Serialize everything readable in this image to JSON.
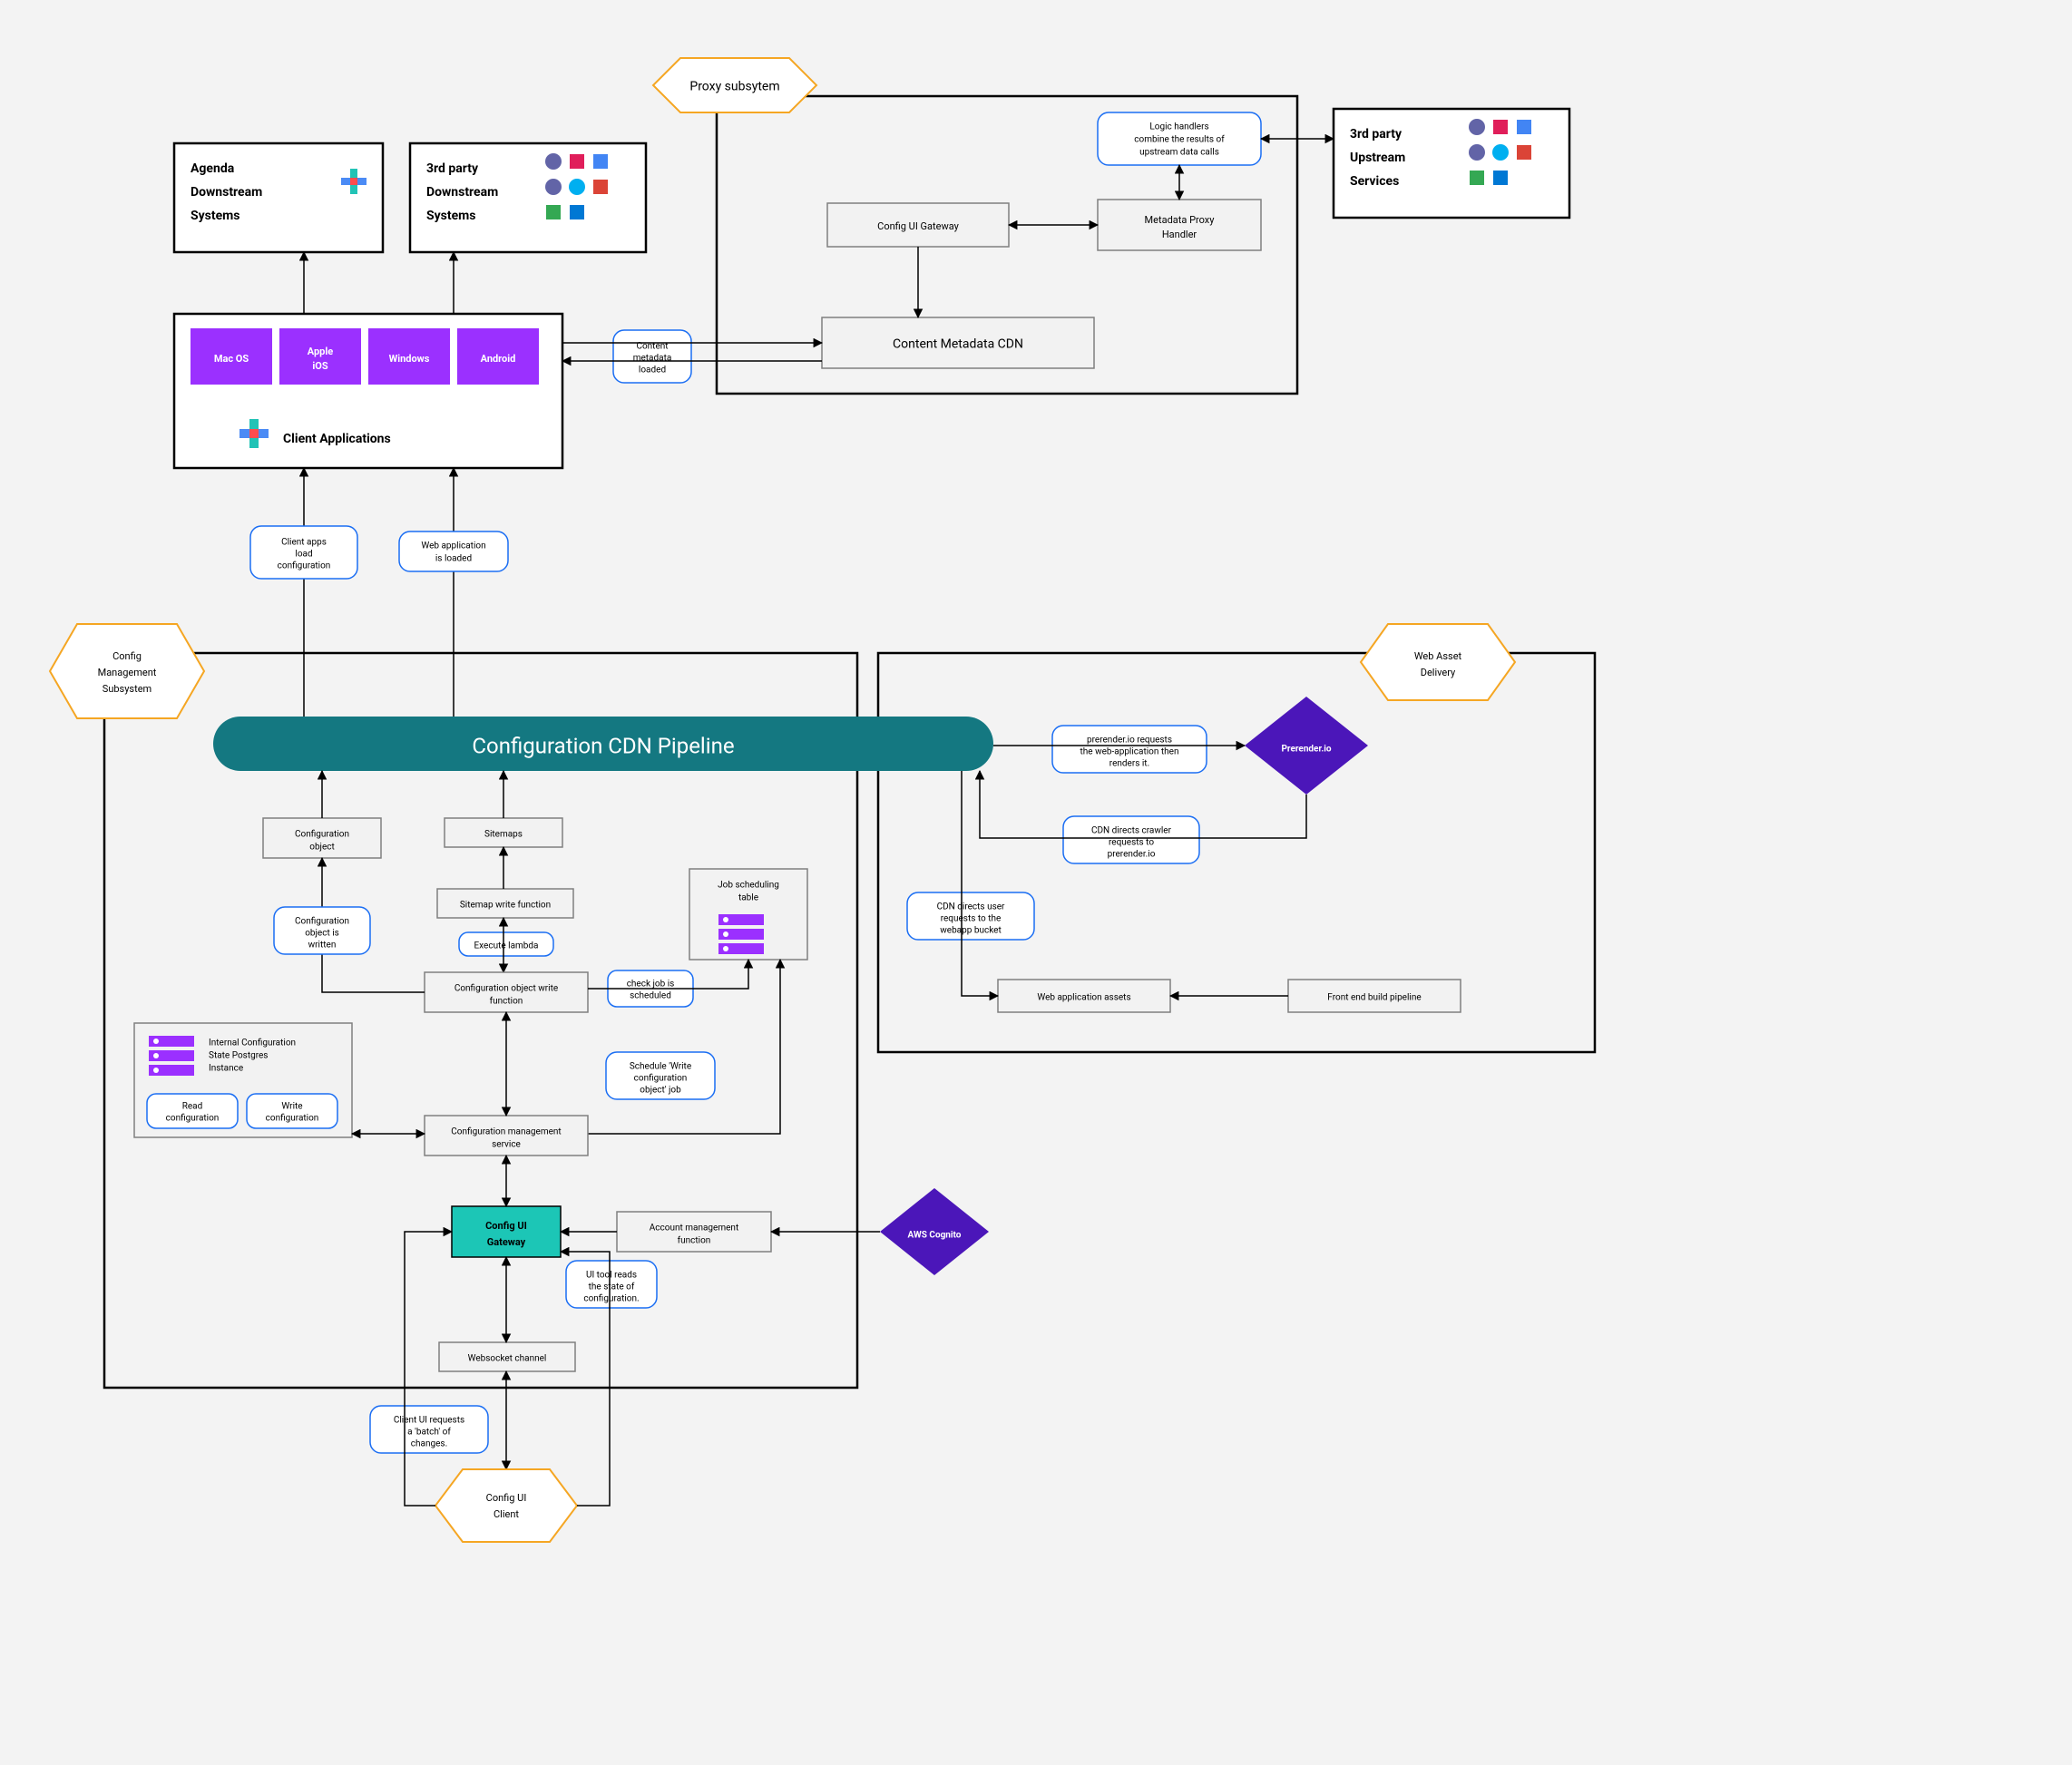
{
  "top": {
    "agenda_box_l1": "Agenda",
    "agenda_box_l2": "Downstream",
    "agenda_box_l3": "Systems",
    "thirdparty_down_l1": "3rd party",
    "thirdparty_down_l2": "Downstream",
    "thirdparty_down_l3": "Systems",
    "thirdparty_up_l1": "3rd party",
    "thirdparty_up_l2": "Upstream",
    "thirdparty_up_l3": "Services"
  },
  "clients": {
    "platforms": {
      "macos": "Mac OS",
      "ios1": "Apple",
      "ios2": "iOS",
      "windows": "Windows",
      "android": "Android"
    },
    "label": "Client Applications"
  },
  "hexes": {
    "proxy": "Proxy subsytem",
    "config_mgmt_l1": "Config",
    "config_mgmt_l2": "Management",
    "config_mgmt_l3": "Subsystem",
    "web_asset_l1": "Web Asset",
    "web_asset_l2": "Delivery",
    "config_ui_client_l1": "Config UI",
    "config_ui_client_l2": "Client"
  },
  "proxy": {
    "logic_handlers_l1": "Logic handlers",
    "logic_handlers_l2": "combine the results of",
    "logic_handlers_l3": "upstream data calls",
    "metadata_proxy_l1": "Metadata Proxy",
    "metadata_proxy_l2": "Handler",
    "config_ui_gateway": "Config UI Gateway",
    "content_cdn": "Content Metadata CDN"
  },
  "annot": {
    "content_loaded_l1": "Content",
    "content_loaded_l2": "metadata",
    "content_loaded_l3": "loaded",
    "client_apps_load_l1": "Client apps",
    "client_apps_load_l2": "load",
    "client_apps_load_l3": "configuration",
    "webapp_loaded_l1": "Web application",
    "webapp_loaded_l2": "is loaded",
    "config_obj_written_l1": "Configuration",
    "config_obj_written_l2": "object is",
    "config_obj_written_l3": "written",
    "execute_lambda": "Execute lambda",
    "check_job_l1": "check job is",
    "check_job_l2": "scheduled",
    "schedule_job_l1": "Schedule 'Write",
    "schedule_job_l2": "configuration",
    "schedule_job_l3": "object' job",
    "read_config_l1": "Read",
    "read_config_l2": "configuration",
    "write_config_l1": "Write",
    "write_config_l2": "configuration",
    "ui_reads_l1": "UI tool reads",
    "ui_reads_l2": "the state of",
    "ui_reads_l3": "configuration.",
    "client_batch_l1": "Client UI requests",
    "client_batch_l2": "a 'batch' of",
    "client_batch_l3": "changes.",
    "prerender_req_l1": "prerender.io requests",
    "prerender_req_l2": "the web-application then",
    "prerender_req_l3": "renders it.",
    "cdn_crawler_l1": "CDN directs crawler",
    "cdn_crawler_l2": "requests to",
    "cdn_crawler_l3": "prerender.io",
    "cdn_user_l1": "CDN directs user",
    "cdn_user_l2": "requests to the",
    "cdn_user_l3": "webapp bucket"
  },
  "cdn_pill": "Configuration CDN Pipeline",
  "cfg": {
    "config_object_l1": "Configuration",
    "config_object_l2": "object",
    "sitemaps": "Sitemaps",
    "sitemap_write": "Sitemap write function",
    "cow_l1": "Configuration object write",
    "cow_l2": "function",
    "job_table_l1": "Job scheduling",
    "job_table_l2": "table",
    "icp_l1": "Internal Configuration",
    "icp_l2": "State Postgres",
    "icp_l3": "Instance",
    "cms_l1": "Configuration management",
    "cms_l2": "service",
    "gateway_l1": "Config UI",
    "gateway_l2": "Gateway",
    "acct_mgmt_l1": "Account management",
    "acct_mgmt_l2": "function",
    "websocket": "Websocket channel",
    "aws_cognito": "AWS Cognito",
    "prerender": "Prerender.io",
    "web_assets": "Web application assets",
    "fe_build": "Front end build pipeline"
  },
  "chart_data": {
    "type": "architecture-diagram",
    "subsystems": [
      {
        "name": "Proxy subsystem",
        "nodes": [
          "Config UI Gateway",
          "Metadata Proxy Handler",
          "Content Metadata CDN"
        ],
        "annotations": [
          "Logic handlers combine the results of upstream data calls"
        ]
      },
      {
        "name": "Config Management Subsystem",
        "nodes": [
          "Configuration CDN Pipeline",
          "Configuration object",
          "Sitemaps",
          "Sitemap write function",
          "Configuration object write function",
          "Job scheduling table",
          "Internal Configuration State Postgres Instance",
          "Configuration management service",
          "Config UI Gateway",
          "Account management function",
          "Websocket channel"
        ],
        "annotations": [
          "Configuration object is written",
          "Execute lambda",
          "check job is scheduled",
          "Schedule 'Write configuration object' job",
          "Read configuration",
          "Write configuration",
          "UI tool reads the state of configuration.",
          "Client UI requests a 'batch' of changes."
        ]
      },
      {
        "name": "Web Asset Delivery",
        "nodes": [
          "Prerender.io",
          "Web application assets",
          "Front end build pipeline"
        ],
        "annotations": [
          "prerender.io requests the web-application then renders it.",
          "CDN directs crawler requests to prerender.io",
          "CDN directs user requests to the webapp bucket"
        ]
      }
    ],
    "external_services": [
      "AWS Cognito",
      "Config UI Client"
    ],
    "top_level_nodes": [
      "Agenda Downstream Systems",
      "3rd party Downstream Systems",
      "3rd party Upstream Services",
      "Client Applications"
    ],
    "client_platforms": [
      "Mac OS",
      "Apple iOS",
      "Windows",
      "Android"
    ],
    "edges": [
      {
        "from": "Client Applications",
        "to": "Agenda Downstream Systems"
      },
      {
        "from": "Client Applications",
        "to": "3rd party Downstream Systems"
      },
      {
        "from": "Client Applications",
        "to": "Config UI Gateway (proxy)",
        "bidirectional": true,
        "via": "Content metadata loaded"
      },
      {
        "from": "Logic handlers",
        "to": "3rd party Upstream Services",
        "bidirectional": true
      },
      {
        "from": "Logic handlers",
        "to": "Metadata Proxy Handler",
        "bidirectional": true
      },
      {
        "from": "Config UI Gateway (proxy)",
        "to": "Metadata Proxy Handler",
        "bidirectional": true
      },
      {
        "from": "Config UI Gateway (proxy)",
        "to": "Content Metadata CDN"
      },
      {
        "from": "Configuration CDN Pipeline",
        "to": "Client Applications",
        "label": "Client apps load configuration"
      },
      {
        "from": "Configuration CDN Pipeline",
        "to": "Client Applications",
        "label": "Web application is loaded"
      },
      {
        "from": "Configuration object",
        "to": "Configuration CDN Pipeline"
      },
      {
        "from": "Sitemaps",
        "to": "Configuration CDN Pipeline"
      },
      {
        "from": "Configuration object write function",
        "to": "Configuration object",
        "label": "Configuration object is written"
      },
      {
        "from": "Sitemap write function",
        "to": "Sitemaps"
      },
      {
        "from": "Sitemap write function",
        "to": "Configuration object write function",
        "label": "Execute lambda",
        "bidirectional": true
      },
      {
        "from": "Configuration object write function",
        "to": "Job scheduling table",
        "label": "check job is scheduled"
      },
      {
        "from": "Configuration management service",
        "to": "Job scheduling table",
        "label": "Schedule 'Write configuration object' job"
      },
      {
        "from": "Configuration object write function",
        "to": "Configuration management service",
        "bidirectional": true
      },
      {
        "from": "Internal Configuration State Postgres Instance",
        "to": "Configuration management service",
        "bidirectional": true
      },
      {
        "from": "Config UI Gateway",
        "to": "Configuration management service",
        "bidirectional": true
      },
      {
        "from": "Account management function",
        "to": "Config UI Gateway"
      },
      {
        "from": "AWS Cognito",
        "to": "Account management function"
      },
      {
        "from": "Config UI Gateway",
        "to": "Websocket channel",
        "bidirectional": true
      },
      {
        "from": "Websocket channel",
        "to": "Config UI Client",
        "bidirectional": true
      },
      {
        "from": "Config UI Client",
        "to": "Config UI Gateway",
        "label": "UI tool reads the state of configuration."
      },
      {
        "from": "Config UI Client",
        "to": "Websocket channel",
        "label": "Client UI requests a 'batch' of changes."
      },
      {
        "from": "Configuration CDN Pipeline",
        "to": "Prerender.io",
        "label": "prerender.io requests the web-application then renders it."
      },
      {
        "from": "Prerender.io",
        "to": "Configuration CDN Pipeline",
        "label": "CDN directs crawler requests to prerender.io"
      },
      {
        "from": "Configuration CDN Pipeline",
        "to": "Web application assets",
        "label": "CDN directs user requests to the webapp bucket"
      },
      {
        "from": "Front end build pipeline",
        "to": "Web application assets"
      }
    ]
  }
}
